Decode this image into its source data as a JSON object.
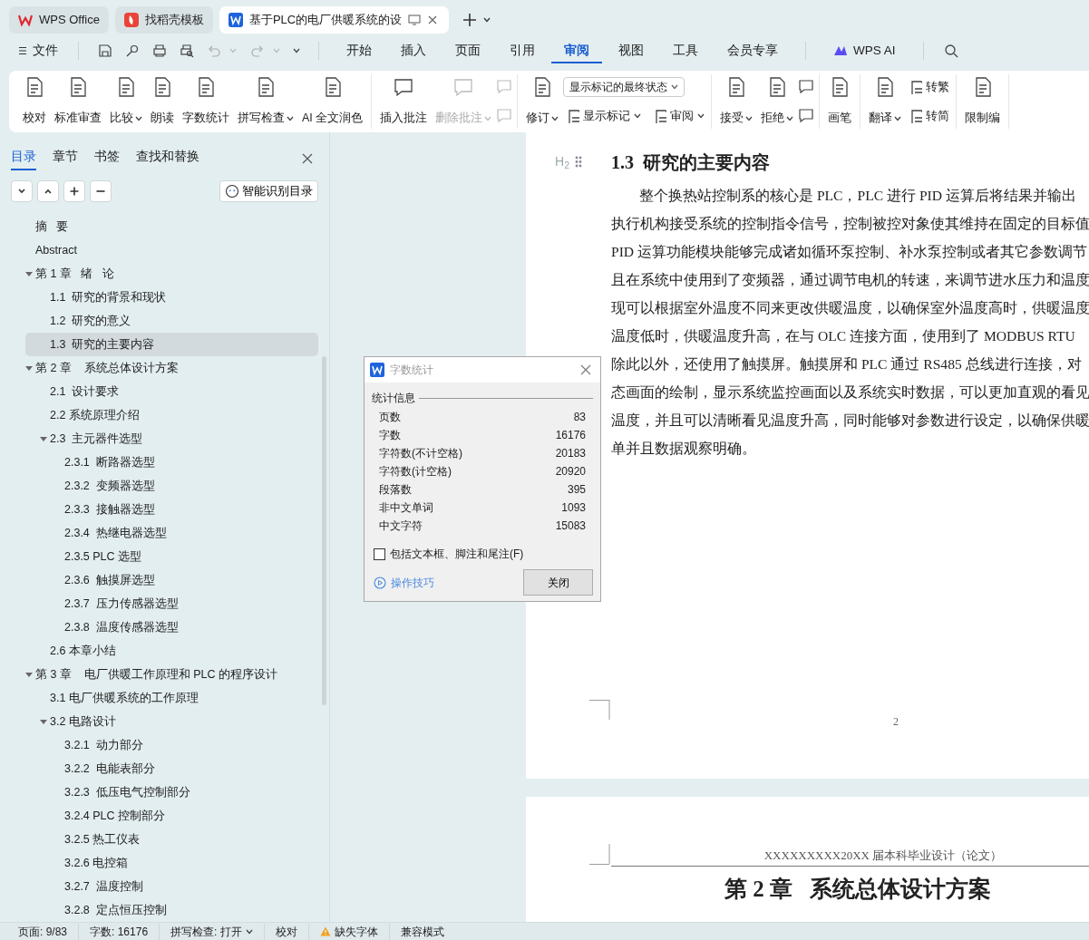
{
  "title_tabs": [
    {
      "label": "WPS Office",
      "selected": false
    },
    {
      "label": "找稻壳模板",
      "selected": false
    },
    {
      "label": "基于PLC的电厂供暖系统的设",
      "selected": true
    }
  ],
  "menu": {
    "file": "文件",
    "tabs": [
      {
        "label": "开始",
        "selected": false
      },
      {
        "label": "插入",
        "selected": false
      },
      {
        "label": "页面",
        "selected": false
      },
      {
        "label": "引用",
        "selected": false
      },
      {
        "label": "审阅",
        "selected": true
      },
      {
        "label": "视图",
        "selected": false
      },
      {
        "label": "工具",
        "selected": false
      },
      {
        "label": "会员专享",
        "selected": false
      }
    ],
    "ai": "WPS AI"
  },
  "ribbon": [
    [
      {
        "kind": "large",
        "label": "校对",
        "caret": false,
        "disabled": false
      },
      {
        "kind": "large",
        "label": "标准审查",
        "caret": false,
        "disabled": false
      },
      {
        "kind": "large",
        "label": "比较",
        "caret": true,
        "disabled": false
      },
      {
        "kind": "large",
        "label": "朗读",
        "caret": false,
        "disabled": false
      },
      {
        "kind": "large",
        "label": "字数统计",
        "caret": false,
        "disabled": false
      },
      {
        "kind": "large",
        "label": "拼写检查",
        "caret": true,
        "disabled": false
      },
      {
        "kind": "large",
        "label": "AI 全文润色",
        "caret": false,
        "disabled": false
      }
    ],
    [
      {
        "kind": "large",
        "label": "插入批注",
        "caret": false,
        "disabled": false
      },
      {
        "kind": "large",
        "label": "删除批注",
        "caret": true,
        "disabled": true
      },
      {
        "kind": "stack",
        "rows": [
          [
            {
              "kind": "icon",
              "disabled": true
            }
          ],
          [
            {
              "kind": "icon",
              "disabled": true
            }
          ]
        ]
      }
    ],
    [
      {
        "kind": "large",
        "label": "修订",
        "caret": true,
        "disabled": false
      },
      {
        "kind": "stack",
        "rows": [
          [
            {
              "kind": "select",
              "value": "显示标记的最终状态"
            }
          ],
          [
            {
              "kind": "small",
              "label": "显示标记",
              "caret": true,
              "disabled": false
            },
            {
              "kind": "small",
              "label": "审阅",
              "caret": true,
              "disabled": false
            }
          ]
        ]
      }
    ],
    [
      {
        "kind": "large",
        "label": "接受",
        "caret": true,
        "disabled": false
      },
      {
        "kind": "large",
        "label": "拒绝",
        "caret": true,
        "disabled": false
      },
      {
        "kind": "stack",
        "rows": [
          [
            {
              "kind": "icon",
              "disabled": false
            }
          ],
          [
            {
              "kind": "icon",
              "disabled": false
            }
          ]
        ]
      }
    ],
    [
      {
        "kind": "large",
        "label": "画笔",
        "caret": false,
        "disabled": false
      }
    ],
    [
      {
        "kind": "large",
        "label": "翻译",
        "caret": true,
        "disabled": false
      },
      {
        "kind": "stack",
        "rows": [
          [
            {
              "kind": "small",
              "label": "转繁",
              "caret": false,
              "disabled": false
            }
          ],
          [
            {
              "kind": "small",
              "label": "转简",
              "caret": false,
              "disabled": false
            }
          ]
        ]
      }
    ],
    [
      {
        "kind": "large",
        "label": "限制编",
        "caret": false,
        "disabled": false
      }
    ]
  ],
  "sidebar": {
    "tabs": [
      {
        "label": "目录",
        "selected": true
      },
      {
        "label": "章节",
        "selected": false
      },
      {
        "label": "书签",
        "selected": false
      },
      {
        "label": "查找和替换",
        "selected": false
      }
    ],
    "smart_button": "智能识别目录",
    "toc": [
      {
        "label": "摘   要",
        "selected": false
      },
      {
        "label": "Abstract",
        "selected": false
      },
      {
        "label": "第 1 章   绪   论",
        "selected": false,
        "expanded": true,
        "children": [
          {
            "label": "1.1  研究的背景和现状",
            "selected": false
          },
          {
            "label": "1.2  研究的意义",
            "selected": false
          },
          {
            "label": "1.3  研究的主要内容",
            "selected": true
          }
        ]
      },
      {
        "label": "第 2 章    系统总体设计方案",
        "selected": false,
        "expanded": true,
        "children": [
          {
            "label": "2.1  设计要求",
            "selected": false
          },
          {
            "label": "2.2 系统原理介绍",
            "selected": false
          },
          {
            "label": "2.3  主元器件选型",
            "selected": false,
            "expanded": true,
            "children": [
              {
                "label": "2.3.1  断路器选型",
                "selected": false
              },
              {
                "label": "2.3.2  变频器选型",
                "selected": false
              },
              {
                "label": "2.3.3  接触器选型",
                "selected": false
              },
              {
                "label": "2.3.4  热继电器选型",
                "selected": false
              },
              {
                "label": "2.3.5 PLC 选型",
                "selected": false
              },
              {
                "label": "2.3.6  触摸屏选型",
                "selected": false
              },
              {
                "label": "2.3.7  压力传感器选型",
                "selected": false
              },
              {
                "label": "2.3.8  温度传感器选型",
                "selected": false
              }
            ]
          },
          {
            "label": "2.6 本章小结",
            "selected": false
          }
        ]
      },
      {
        "label": "第 3 章    电厂供暖工作原理和 PLC 的程序设计",
        "selected": false,
        "expanded": true,
        "children": [
          {
            "label": "3.1 电厂供暖系统的工作原理",
            "selected": false
          },
          {
            "label": "3.2 电路设计",
            "selected": false,
            "expanded": true,
            "children": [
              {
                "label": "3.2.1  动力部分",
                "selected": false
              },
              {
                "label": "3.2.2  电能表部分",
                "selected": false
              },
              {
                "label": "3.2.3  低压电气控制部分",
                "selected": false
              },
              {
                "label": "3.2.4 PLC 控制部分",
                "selected": false
              },
              {
                "label": "3.2.5 热工仪表",
                "selected": false
              },
              {
                "label": "3.2.6 电控箱",
                "selected": false
              },
              {
                "label": "3.2.7  温度控制",
                "selected": false
              },
              {
                "label": "3.2.8  定点恒压控制",
                "selected": false
              }
            ]
          }
        ]
      }
    ]
  },
  "document": {
    "heading_marker": "H$_{2}$",
    "heading": "1.3  研究的主要内容",
    "lines": [
      "整个换热站控制系的核心是 PLC，PLC 进行 PID 运算后将结果并输出",
      "执行机构接受系统的控制指令信号，控制被控对象使其维持在固定的目标值",
      "PID 运算功能模块能够完成诸如循环泵控制、补水泵控制或者其它参数调节",
      "且在系统中使用到了变频器，通过调节电机的转速，来调节进水压力和温度",
      "现可以根据室外温度不同来更改供暖温度，以确保室外温度高时，供暖温度",
      "温度低时，供暖温度升高，在与 OLC 连接方面，使用到了 MODBUS RTU",
      "除此以外，还使用了触摸屏。触摸屏和 PLC 通过 RS485 总线进行连接，对",
      "态画面的绘制，显示系统监控画面以及系统实时数据，可以更加直观的看见",
      "温度，并且可以清晰看见温度升高，同时能够对参数进行设定，以确保供暖",
      "单并且数据观察明确。"
    ],
    "page_number": "2",
    "next_page": {
      "header": "XXXXXXXXX20XX 届本科毕业设计（论文）",
      "heading": "第 2 章   系统总体设计方案"
    }
  },
  "dialog": {
    "title": "字数统计",
    "section": "统计信息",
    "stats": [
      {
        "label": "页数",
        "value": "83"
      },
      {
        "label": "字数",
        "value": "16176"
      },
      {
        "label": "字符数(不计空格)",
        "value": "20183"
      },
      {
        "label": "字符数(计空格)",
        "value": "20920"
      },
      {
        "label": "段落数",
        "value": "395"
      },
      {
        "label": "非中文单词",
        "value": "1093"
      },
      {
        "label": "中文字符",
        "value": "15083"
      }
    ],
    "checkbox": {
      "label": "包括文本框、脚注和尾注(F)",
      "checked": false
    },
    "tips": "操作技巧",
    "button": "关闭"
  },
  "status_bar": [
    {
      "kind": "text",
      "label": "页面: 9/83"
    },
    {
      "kind": "text",
      "label": "字数: 16176"
    },
    {
      "kind": "dropdown",
      "label": "拼写检查: 打开"
    },
    {
      "kind": "text",
      "label": "校对"
    },
    {
      "kind": "warning",
      "label": "缺失字体"
    },
    {
      "kind": "text",
      "label": "兼容模式"
    }
  ]
}
